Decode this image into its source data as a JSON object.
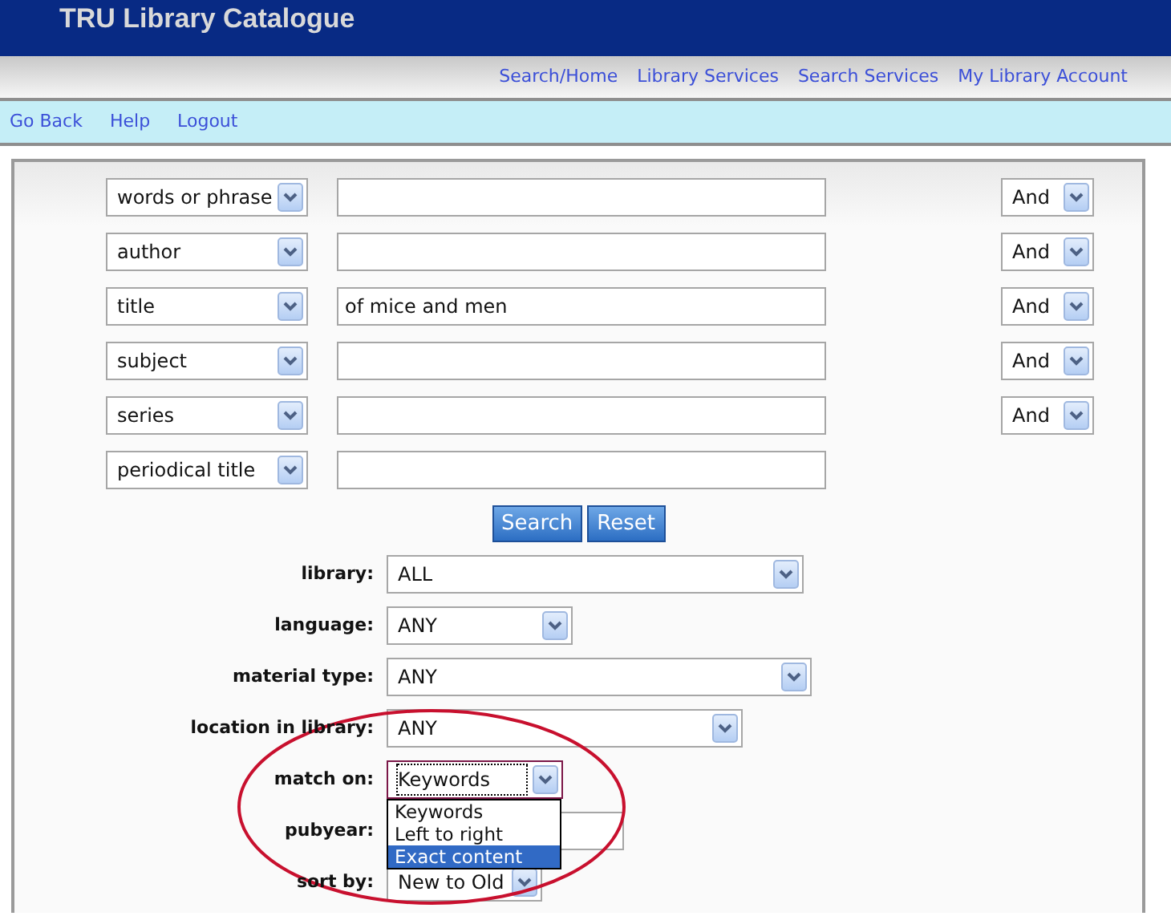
{
  "header": {
    "title": "TRU Library Catalogue"
  },
  "top_nav": [
    "Search/Home",
    "Library Services",
    "Search Services",
    "My Library Account"
  ],
  "sub_nav": [
    "Go Back",
    "Help",
    "Logout"
  ],
  "search_rows": [
    {
      "field": "words or phrase",
      "operator": "And"
    },
    {
      "field": "author",
      "operator": "And"
    },
    {
      "field": "title",
      "value": "of mice and men",
      "operator": "And"
    },
    {
      "field": "subject",
      "operator": "And"
    },
    {
      "field": "series",
      "operator": "And"
    },
    {
      "field": "periodical title"
    }
  ],
  "buttons": [
    "Search",
    "Reset"
  ],
  "filters": [
    {
      "label": "library:",
      "kind": "select",
      "value": "ALL",
      "focused": false
    },
    {
      "label": "language:",
      "kind": "select",
      "value": "ANY",
      "focused": false
    },
    {
      "label": "material type:",
      "kind": "select",
      "value": "ANY",
      "focused": false
    },
    {
      "label": "location in library:",
      "kind": "select",
      "value": "ANY",
      "focused": false
    },
    {
      "label": "match on:",
      "kind": "select",
      "value": "Keywords",
      "focused": true,
      "open": true
    },
    {
      "label": "pubyear:",
      "kind": "input",
      "focused": false
    },
    {
      "label": "sort by:",
      "kind": "select",
      "value": "New to Old",
      "focused": false
    }
  ],
  "dropdown": {
    "options": [
      {
        "label": "Keywords",
        "selected": false
      },
      {
        "label": "Left to right",
        "selected": false
      },
      {
        "label": "Exact content",
        "selected": true
      }
    ]
  }
}
